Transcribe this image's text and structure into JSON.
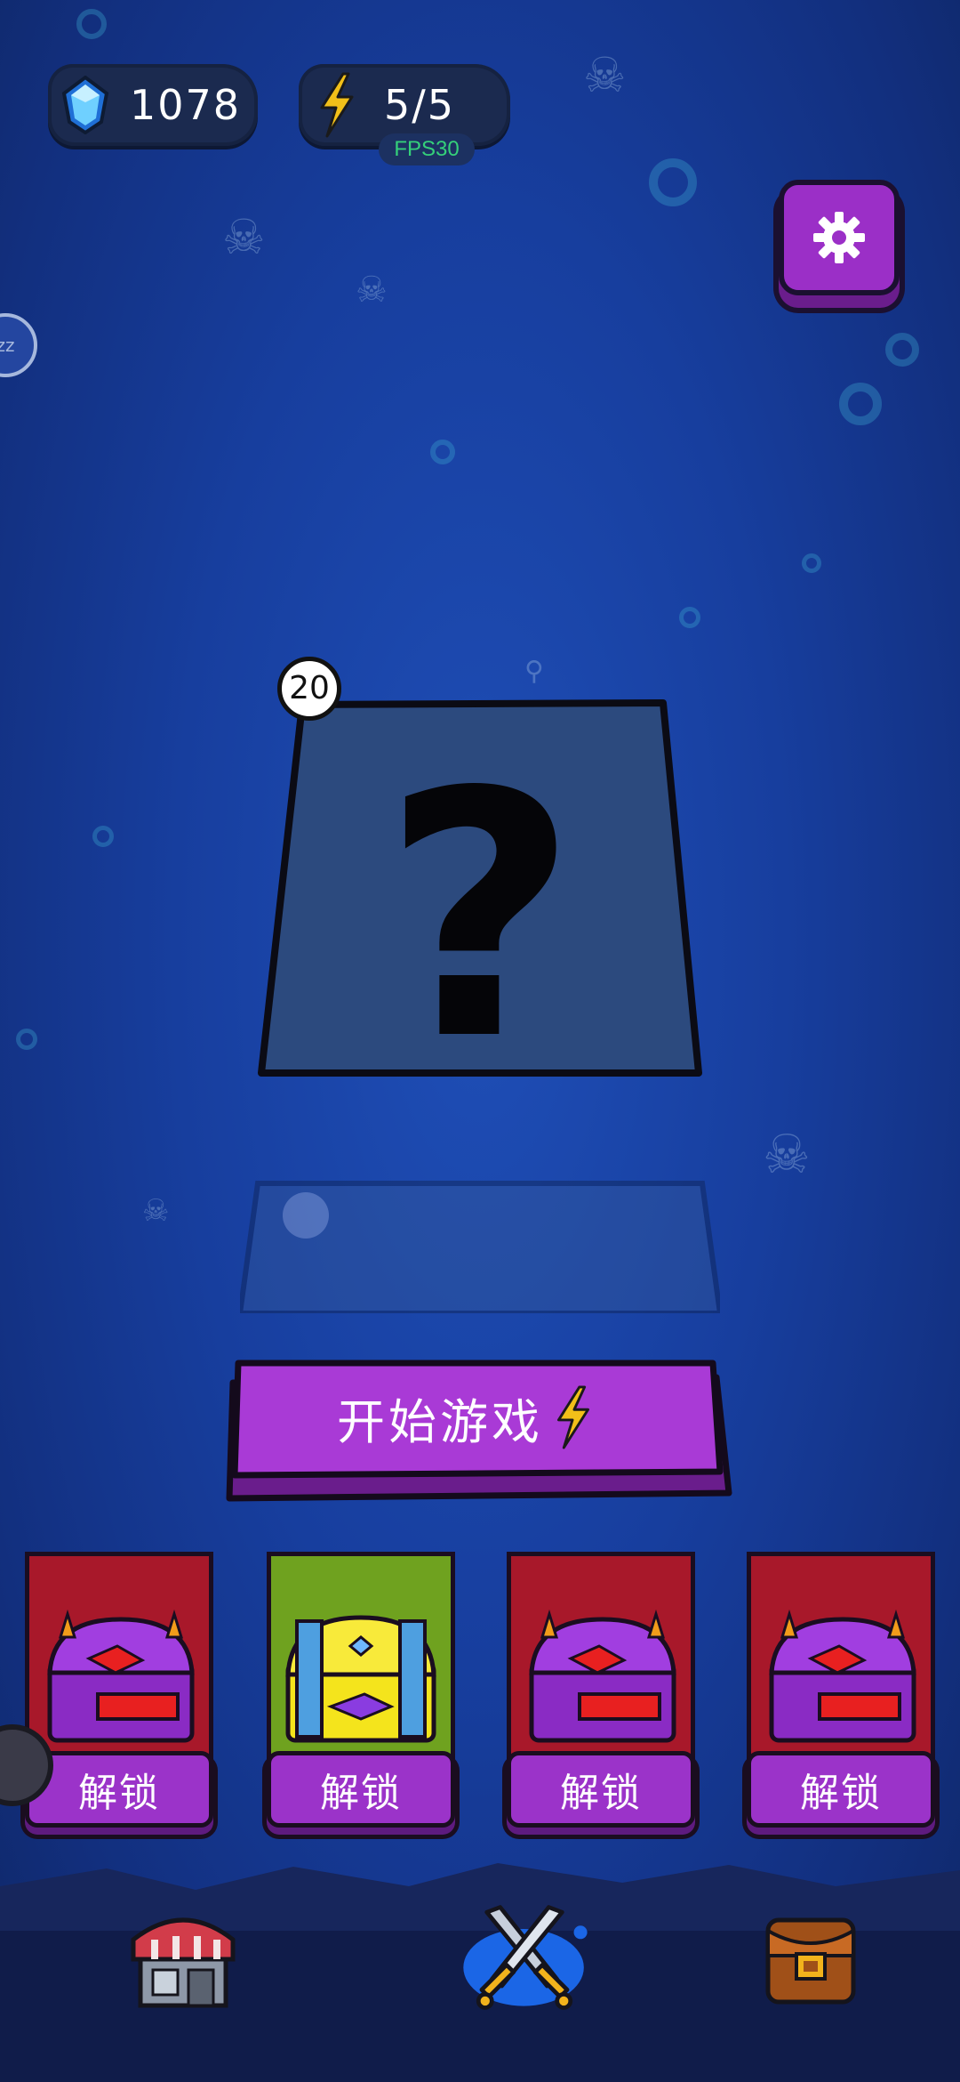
{
  "resources": {
    "gems": "1078",
    "energy": "5/5",
    "fps": "FPS30"
  },
  "mystery_card": {
    "symbol": "?",
    "level": "20"
  },
  "start_button": {
    "label": "开始游戏"
  },
  "chests": [
    {
      "color": "red",
      "unlock_label": "解锁",
      "panel_color": "#a8182a"
    },
    {
      "color": "green",
      "unlock_label": "解锁",
      "panel_color": "#6fa21f"
    },
    {
      "color": "red",
      "unlock_label": "解锁",
      "panel_color": "#a8182a"
    },
    {
      "color": "red",
      "unlock_label": "解锁",
      "panel_color": "#a8182a"
    }
  ],
  "bottom_nav": [
    {
      "icon": "shop-icon"
    },
    {
      "icon": "battle-icon",
      "active": true
    },
    {
      "icon": "backpack-icon"
    }
  ],
  "colors": {
    "accent_purple": "#9b33c9",
    "background_blue": "#173e9e",
    "energy_yellow": "#f2c019",
    "gem_blue": "#5fc4ff"
  }
}
